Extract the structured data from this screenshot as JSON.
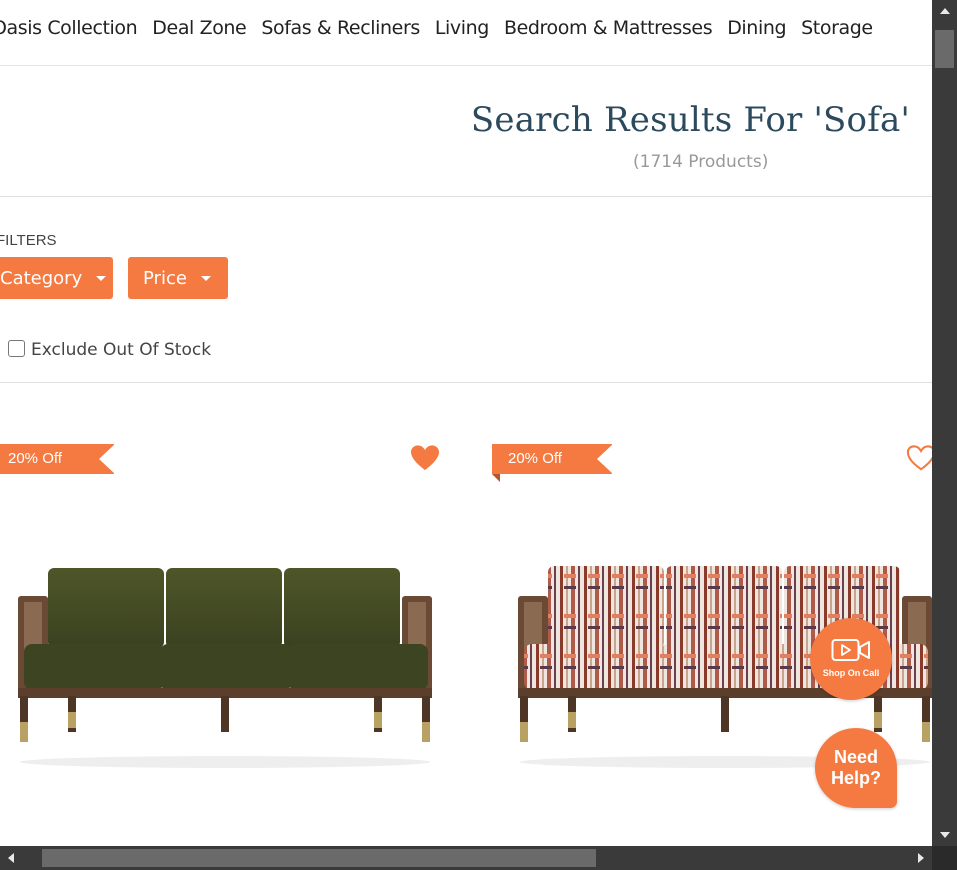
{
  "nav": {
    "items": [
      "Oasis Collection",
      "Deal Zone",
      "Sofas & Recliners",
      "Living",
      "Bedroom & Mattresses",
      "Dining",
      "Storage"
    ]
  },
  "search": {
    "title": "Search Results For 'Sofa'",
    "count": "(1714 Products)"
  },
  "filters": {
    "label": "FILTERS",
    "category_label": "Category",
    "price_label": "Price",
    "exclude_label": "Exclude Out Of Stock",
    "exclude_checked": false
  },
  "products": [
    {
      "discount": "20% Off",
      "wishlisted": true,
      "upholstery": "olive-green-velvet"
    },
    {
      "discount": "20% Off",
      "wishlisted": false,
      "upholstery": "aztec-stripe-fabric"
    }
  ],
  "floating": {
    "shop_on_call": "Shop On Call",
    "need_help": "Need Help?"
  },
  "colors": {
    "accent": "#f47a41",
    "title": "#2b4a5e"
  }
}
